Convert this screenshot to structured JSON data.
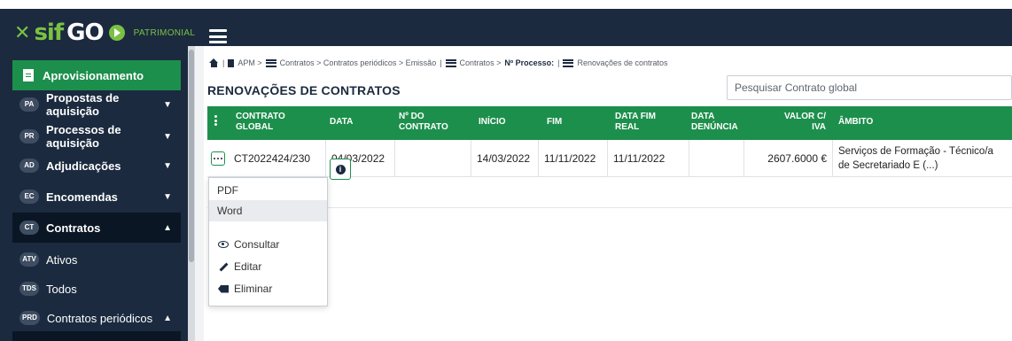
{
  "app": {
    "logo_x": "✕",
    "logo_sif": "sif",
    "logo_go": "GO",
    "logo_sub": "PATRIMONIAL"
  },
  "sidebar": {
    "items": [
      {
        "badge": "",
        "label": "Aprovisionamento"
      },
      {
        "badge": "PA",
        "label": "Propostas de aquisição",
        "chevron": "▼"
      },
      {
        "badge": "PR",
        "label": "Processos de aquisição",
        "chevron": "▼"
      },
      {
        "badge": "AD",
        "label": "Adjudicações",
        "chevron": "▼"
      },
      {
        "badge": "EC",
        "label": "Encomendas",
        "chevron": "▼"
      },
      {
        "badge": "CT",
        "label": "Contratos",
        "chevron": "▲"
      },
      {
        "badge": "ATV",
        "label": "Ativos"
      },
      {
        "badge": "TDS",
        "label": "Todos"
      },
      {
        "badge": "PRD",
        "label": "Contratos periódicos",
        "chevron": "▲"
      }
    ]
  },
  "breadcrumb": {
    "sep": "|",
    "part1": "APM >",
    "part2": "Contratos > Contratos periódicos > Emissão",
    "part3": "Contratos >",
    "part3_bold": "Nº Processo:",
    "part4": "Renovações de contratos"
  },
  "page": {
    "title": "RENOVAÇÕES DE CONTRATOS",
    "search_placeholder": "Pesquisar Contrato global"
  },
  "table": {
    "headers": {
      "contrato_global": "CONTRATO GLOBAL",
      "data": "DATA",
      "n_contrato": "Nº DO CONTRATO",
      "inicio": "INÍCIO",
      "fim": "FIM",
      "data_fim_real": "DATA FIM REAL",
      "data_denuncia": "DATA DENÚNCIA",
      "valor": "VALOR C/ IVA",
      "ambito": "ÂMBITO"
    },
    "rows": [
      {
        "contrato_global": "CT2022424/230",
        "data": "04/03/2022",
        "n_contrato": "",
        "inicio": "14/03/2022",
        "fim": "11/11/2022",
        "data_fim_real": "11/11/2022",
        "data_denuncia": "",
        "valor": "2607.6000 €",
        "ambito": "Serviços de Formação - Técnico/a de Secretariado E (...)"
      }
    ]
  },
  "menu": {
    "items": [
      {
        "label": "PDF",
        "icon": ""
      },
      {
        "label": "Word",
        "icon": ""
      },
      {
        "label": "Consultar",
        "icon": "eye-icon"
      },
      {
        "label": "Editar",
        "icon": "pencil-icon"
      },
      {
        "label": "Eliminar",
        "icon": "eraser-icon"
      }
    ]
  },
  "colors": {
    "navy": "#1b2a3f",
    "green": "#1d8f4c",
    "lime": "#7ac143"
  }
}
